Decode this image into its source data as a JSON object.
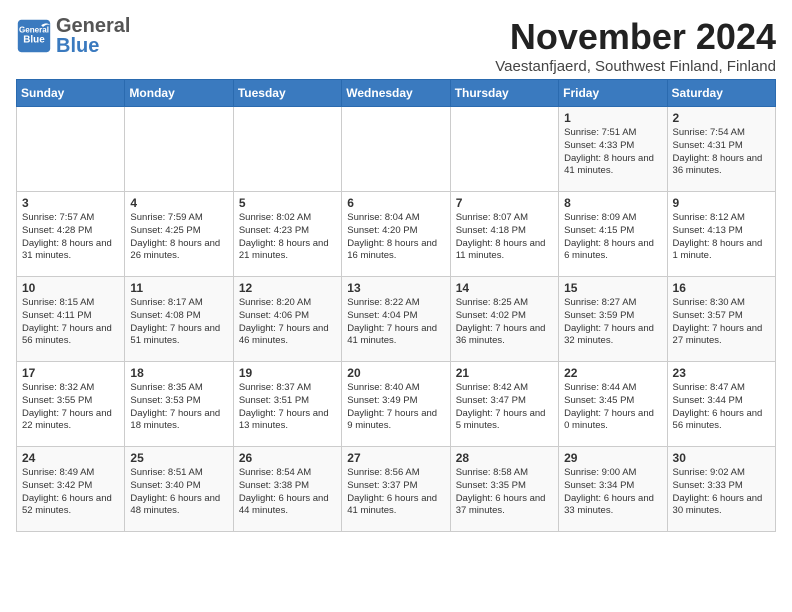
{
  "header": {
    "logo_general": "General",
    "logo_blue": "Blue",
    "month_title": "November 2024",
    "location": "Vaestanfjaerd, Southwest Finland, Finland"
  },
  "weekdays": [
    "Sunday",
    "Monday",
    "Tuesday",
    "Wednesday",
    "Thursday",
    "Friday",
    "Saturday"
  ],
  "weeks": [
    [
      {
        "day": "",
        "info": ""
      },
      {
        "day": "",
        "info": ""
      },
      {
        "day": "",
        "info": ""
      },
      {
        "day": "",
        "info": ""
      },
      {
        "day": "",
        "info": ""
      },
      {
        "day": "1",
        "info": "Sunrise: 7:51 AM\nSunset: 4:33 PM\nDaylight: 8 hours and 41 minutes."
      },
      {
        "day": "2",
        "info": "Sunrise: 7:54 AM\nSunset: 4:31 PM\nDaylight: 8 hours and 36 minutes."
      }
    ],
    [
      {
        "day": "3",
        "info": "Sunrise: 7:57 AM\nSunset: 4:28 PM\nDaylight: 8 hours and 31 minutes."
      },
      {
        "day": "4",
        "info": "Sunrise: 7:59 AM\nSunset: 4:25 PM\nDaylight: 8 hours and 26 minutes."
      },
      {
        "day": "5",
        "info": "Sunrise: 8:02 AM\nSunset: 4:23 PM\nDaylight: 8 hours and 21 minutes."
      },
      {
        "day": "6",
        "info": "Sunrise: 8:04 AM\nSunset: 4:20 PM\nDaylight: 8 hours and 16 minutes."
      },
      {
        "day": "7",
        "info": "Sunrise: 8:07 AM\nSunset: 4:18 PM\nDaylight: 8 hours and 11 minutes."
      },
      {
        "day": "8",
        "info": "Sunrise: 8:09 AM\nSunset: 4:15 PM\nDaylight: 8 hours and 6 minutes."
      },
      {
        "day": "9",
        "info": "Sunrise: 8:12 AM\nSunset: 4:13 PM\nDaylight: 8 hours and 1 minute."
      }
    ],
    [
      {
        "day": "10",
        "info": "Sunrise: 8:15 AM\nSunset: 4:11 PM\nDaylight: 7 hours and 56 minutes."
      },
      {
        "day": "11",
        "info": "Sunrise: 8:17 AM\nSunset: 4:08 PM\nDaylight: 7 hours and 51 minutes."
      },
      {
        "day": "12",
        "info": "Sunrise: 8:20 AM\nSunset: 4:06 PM\nDaylight: 7 hours and 46 minutes."
      },
      {
        "day": "13",
        "info": "Sunrise: 8:22 AM\nSunset: 4:04 PM\nDaylight: 7 hours and 41 minutes."
      },
      {
        "day": "14",
        "info": "Sunrise: 8:25 AM\nSunset: 4:02 PM\nDaylight: 7 hours and 36 minutes."
      },
      {
        "day": "15",
        "info": "Sunrise: 8:27 AM\nSunset: 3:59 PM\nDaylight: 7 hours and 32 minutes."
      },
      {
        "day": "16",
        "info": "Sunrise: 8:30 AM\nSunset: 3:57 PM\nDaylight: 7 hours and 27 minutes."
      }
    ],
    [
      {
        "day": "17",
        "info": "Sunrise: 8:32 AM\nSunset: 3:55 PM\nDaylight: 7 hours and 22 minutes."
      },
      {
        "day": "18",
        "info": "Sunrise: 8:35 AM\nSunset: 3:53 PM\nDaylight: 7 hours and 18 minutes."
      },
      {
        "day": "19",
        "info": "Sunrise: 8:37 AM\nSunset: 3:51 PM\nDaylight: 7 hours and 13 minutes."
      },
      {
        "day": "20",
        "info": "Sunrise: 8:40 AM\nSunset: 3:49 PM\nDaylight: 7 hours and 9 minutes."
      },
      {
        "day": "21",
        "info": "Sunrise: 8:42 AM\nSunset: 3:47 PM\nDaylight: 7 hours and 5 minutes."
      },
      {
        "day": "22",
        "info": "Sunrise: 8:44 AM\nSunset: 3:45 PM\nDaylight: 7 hours and 0 minutes."
      },
      {
        "day": "23",
        "info": "Sunrise: 8:47 AM\nSunset: 3:44 PM\nDaylight: 6 hours and 56 minutes."
      }
    ],
    [
      {
        "day": "24",
        "info": "Sunrise: 8:49 AM\nSunset: 3:42 PM\nDaylight: 6 hours and 52 minutes."
      },
      {
        "day": "25",
        "info": "Sunrise: 8:51 AM\nSunset: 3:40 PM\nDaylight: 6 hours and 48 minutes."
      },
      {
        "day": "26",
        "info": "Sunrise: 8:54 AM\nSunset: 3:38 PM\nDaylight: 6 hours and 44 minutes."
      },
      {
        "day": "27",
        "info": "Sunrise: 8:56 AM\nSunset: 3:37 PM\nDaylight: 6 hours and 41 minutes."
      },
      {
        "day": "28",
        "info": "Sunrise: 8:58 AM\nSunset: 3:35 PM\nDaylight: 6 hours and 37 minutes."
      },
      {
        "day": "29",
        "info": "Sunrise: 9:00 AM\nSunset: 3:34 PM\nDaylight: 6 hours and 33 minutes."
      },
      {
        "day": "30",
        "info": "Sunrise: 9:02 AM\nSunset: 3:33 PM\nDaylight: 6 hours and 30 minutes."
      }
    ]
  ]
}
